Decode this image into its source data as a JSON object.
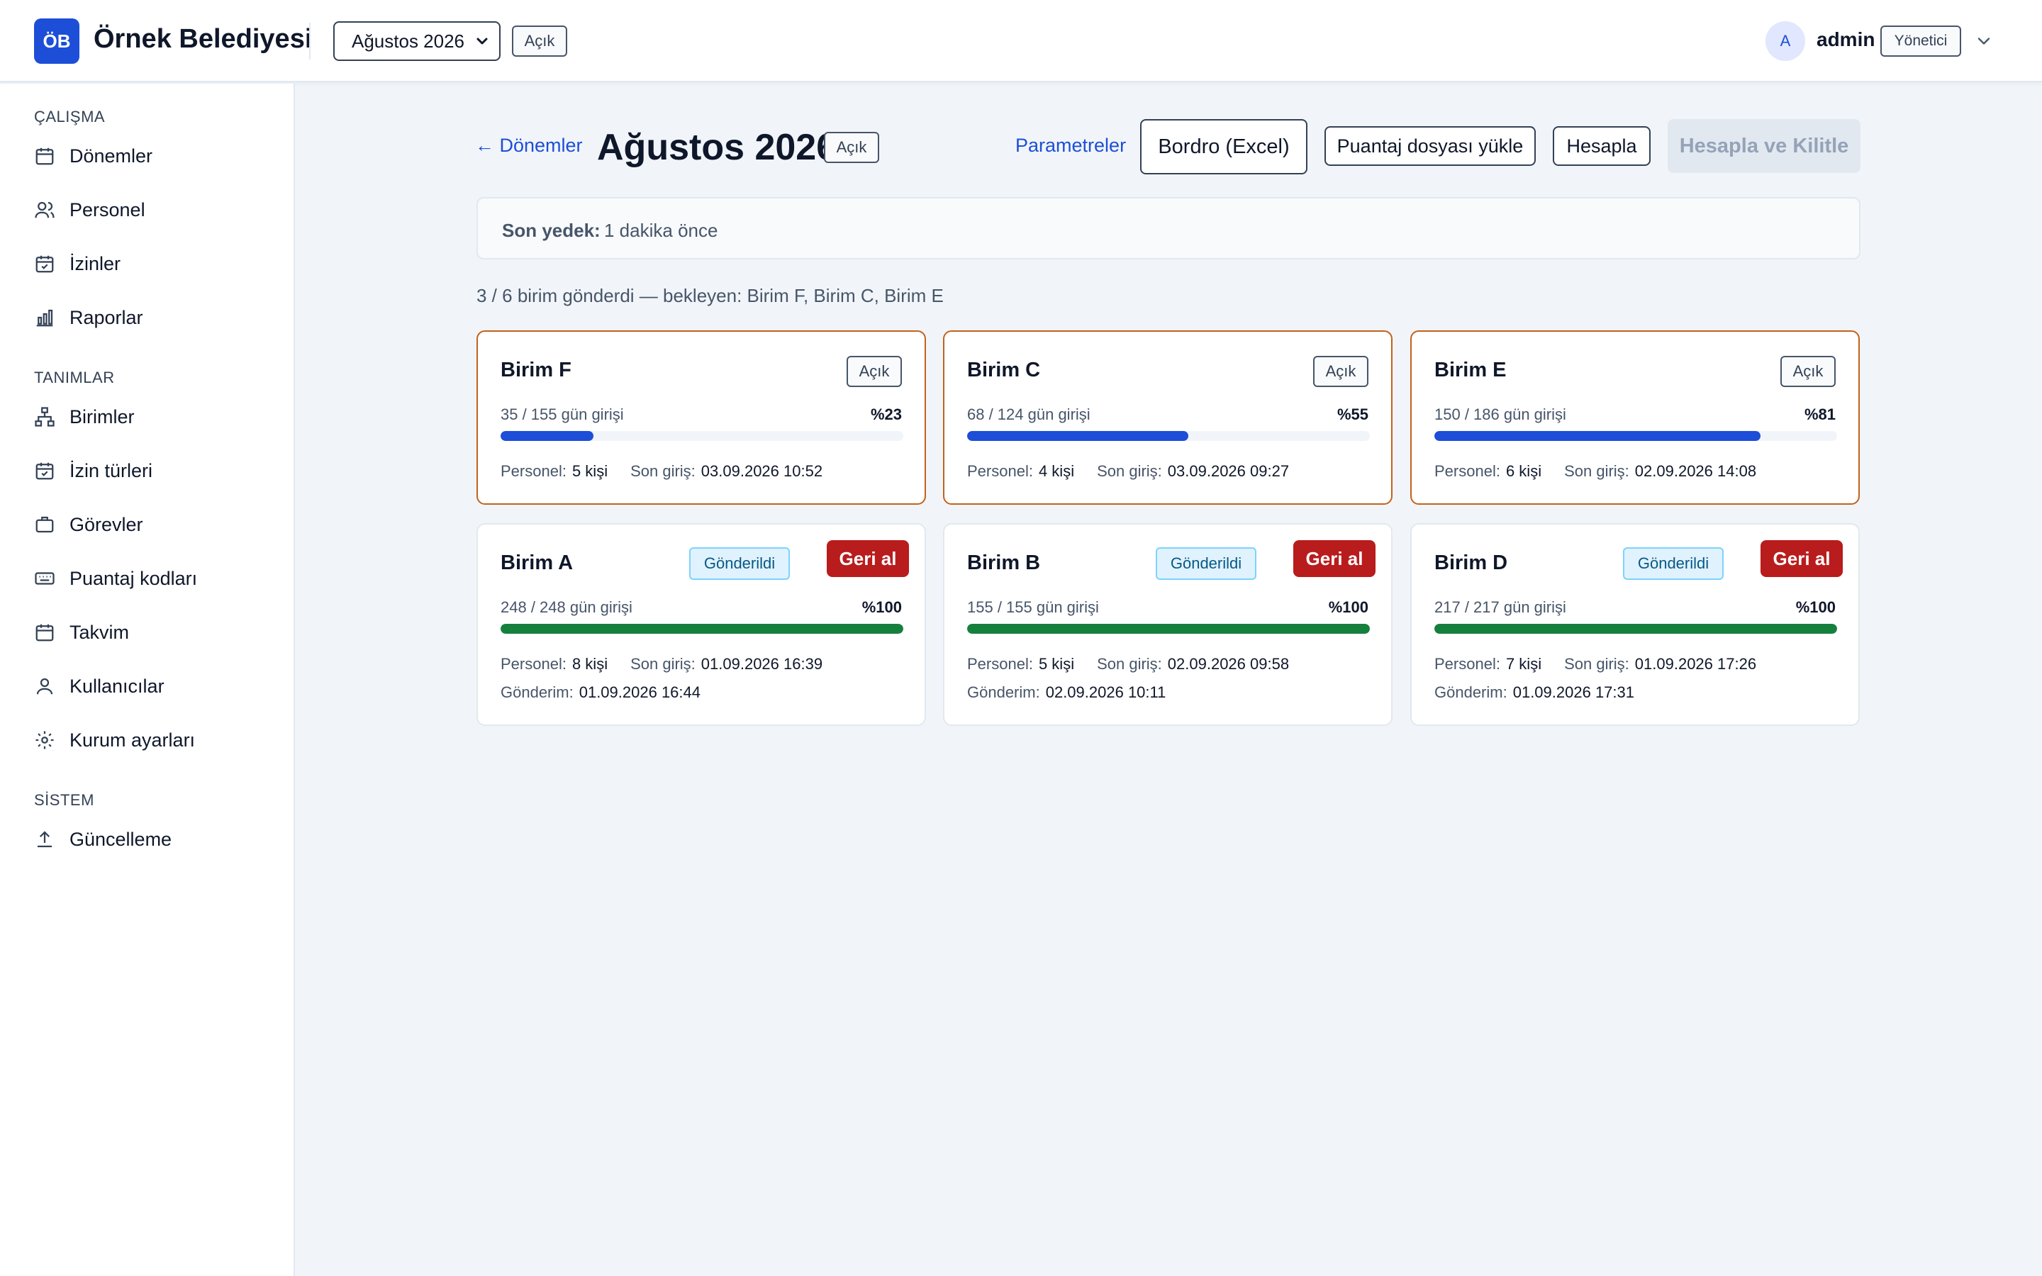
{
  "header": {
    "logo": "ÖB",
    "org_name": "Örnek Belediyesi",
    "period": "Ağustos 2026",
    "period_status": "Açık",
    "avatar": "A",
    "user": "admin",
    "role": "Yönetici"
  },
  "sidebar": {
    "sections": [
      {
        "title": "ÇALIŞMA",
        "items": [
          {
            "label": "Dönemler",
            "icon": "calendar-icon"
          },
          {
            "label": "Personel",
            "icon": "users-icon"
          },
          {
            "label": "İzinler",
            "icon": "calendar-check-icon"
          },
          {
            "label": "Raporlar",
            "icon": "bar-chart-icon"
          }
        ]
      },
      {
        "title": "TANIMLAR",
        "items": [
          {
            "label": "Birimler",
            "icon": "org-chart-icon"
          },
          {
            "label": "İzin türleri",
            "icon": "calendar-check-icon"
          },
          {
            "label": "Görevler",
            "icon": "briefcase-icon"
          },
          {
            "label": "Puantaj kodları",
            "icon": "keyboard-icon"
          },
          {
            "label": "Takvim",
            "icon": "calendar-icon"
          },
          {
            "label": "Kullanıcılar",
            "icon": "user-icon"
          },
          {
            "label": "Kurum ayarları",
            "icon": "gear-icon"
          }
        ]
      },
      {
        "title": "SİSTEM",
        "items": [
          {
            "label": "Güncelleme",
            "icon": "upload-icon"
          }
        ]
      }
    ]
  },
  "main": {
    "back": "← Dönemler",
    "title": "Ağustos 2026",
    "status": "Açık",
    "params": "Parametreler",
    "btn_bordro": "Bordro (Excel)",
    "btn_upload": "Puantaj dosyası yükle",
    "btn_calc": "Hesapla",
    "btn_lock": "Hesapla ve Kilitle",
    "backup_label": "Son yedek:",
    "backup_value": "1 dakika önce",
    "summary": "3 / 6 birim gönderdi — bekleyen: Birim F, Birim C, Birim E"
  },
  "labels": {
    "personel": "Personel:",
    "son_giris": "Son giriş:",
    "gonderim": "Gönderim:",
    "sent": "Gönderildi",
    "undo": "Geri al",
    "open": "Açık"
  },
  "units": [
    {
      "name": "Birim F",
      "state": "pending",
      "progress_text": "35 / 155 gün girişi",
      "pct_text": "%23",
      "progress": 0.23,
      "personel": "5 kişi",
      "son_giris": "03.09.2026 10:52"
    },
    {
      "name": "Birim C",
      "state": "pending",
      "progress_text": "68 / 124 gün girişi",
      "pct_text": "%55",
      "progress": 0.55,
      "personel": "4 kişi",
      "son_giris": "03.09.2026 09:27"
    },
    {
      "name": "Birim E",
      "state": "pending",
      "progress_text": "150 / 186 gün girişi",
      "pct_text": "%81",
      "progress": 0.81,
      "personel": "6 kişi",
      "son_giris": "02.09.2026 14:08"
    },
    {
      "name": "Birim A",
      "state": "sent",
      "progress_text": "248 / 248 gün girişi",
      "pct_text": "%100",
      "progress": 1.0,
      "personel": "8 kişi",
      "son_giris": "01.09.2026 16:39",
      "gonderim": "01.09.2026 16:44"
    },
    {
      "name": "Birim B",
      "state": "sent",
      "progress_text": "155 / 155 gün girişi",
      "pct_text": "%100",
      "progress": 1.0,
      "personel": "5 kişi",
      "son_giris": "02.09.2026 09:58",
      "gonderim": "02.09.2026 10:11"
    },
    {
      "name": "Birim D",
      "state": "sent",
      "progress_text": "217 / 217 gün girişi",
      "pct_text": "%100",
      "progress": 1.0,
      "personel": "7 kişi",
      "son_giris": "01.09.2026 17:26",
      "gonderim": "01.09.2026 17:31"
    }
  ],
  "colors": {
    "accent": "#1d4ed8",
    "pending_border": "#c2621b",
    "bar_progress": "#1d4ed8",
    "bar_complete": "#15803d",
    "danger": "#b91c1c"
  }
}
